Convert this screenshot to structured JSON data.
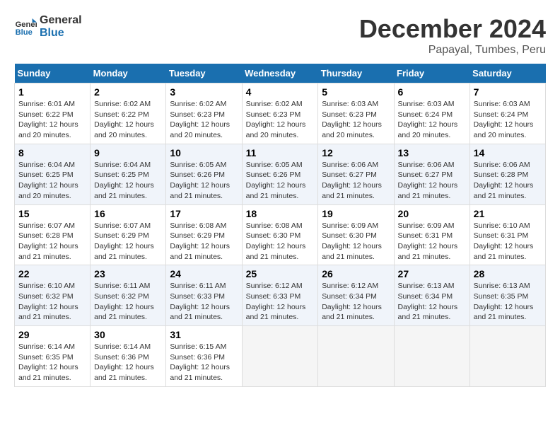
{
  "logo": {
    "line1": "General",
    "line2": "Blue"
  },
  "title": "December 2024",
  "location": "Papayal, Tumbes, Peru",
  "days_of_week": [
    "Sunday",
    "Monday",
    "Tuesday",
    "Wednesday",
    "Thursday",
    "Friday",
    "Saturday"
  ],
  "weeks": [
    [
      {
        "day": "1",
        "sunrise": "6:01 AM",
        "sunset": "6:22 PM",
        "daylight": "12 hours and 20 minutes."
      },
      {
        "day": "2",
        "sunrise": "6:02 AM",
        "sunset": "6:22 PM",
        "daylight": "12 hours and 20 minutes."
      },
      {
        "day": "3",
        "sunrise": "6:02 AM",
        "sunset": "6:23 PM",
        "daylight": "12 hours and 20 minutes."
      },
      {
        "day": "4",
        "sunrise": "6:02 AM",
        "sunset": "6:23 PM",
        "daylight": "12 hours and 20 minutes."
      },
      {
        "day": "5",
        "sunrise": "6:03 AM",
        "sunset": "6:23 PM",
        "daylight": "12 hours and 20 minutes."
      },
      {
        "day": "6",
        "sunrise": "6:03 AM",
        "sunset": "6:24 PM",
        "daylight": "12 hours and 20 minutes."
      },
      {
        "day": "7",
        "sunrise": "6:03 AM",
        "sunset": "6:24 PM",
        "daylight": "12 hours and 20 minutes."
      }
    ],
    [
      {
        "day": "8",
        "sunrise": "6:04 AM",
        "sunset": "6:25 PM",
        "daylight": "12 hours and 20 minutes."
      },
      {
        "day": "9",
        "sunrise": "6:04 AM",
        "sunset": "6:25 PM",
        "daylight": "12 hours and 21 minutes."
      },
      {
        "day": "10",
        "sunrise": "6:05 AM",
        "sunset": "6:26 PM",
        "daylight": "12 hours and 21 minutes."
      },
      {
        "day": "11",
        "sunrise": "6:05 AM",
        "sunset": "6:26 PM",
        "daylight": "12 hours and 21 minutes."
      },
      {
        "day": "12",
        "sunrise": "6:06 AM",
        "sunset": "6:27 PM",
        "daylight": "12 hours and 21 minutes."
      },
      {
        "day": "13",
        "sunrise": "6:06 AM",
        "sunset": "6:27 PM",
        "daylight": "12 hours and 21 minutes."
      },
      {
        "day": "14",
        "sunrise": "6:06 AM",
        "sunset": "6:28 PM",
        "daylight": "12 hours and 21 minutes."
      }
    ],
    [
      {
        "day": "15",
        "sunrise": "6:07 AM",
        "sunset": "6:28 PM",
        "daylight": "12 hours and 21 minutes."
      },
      {
        "day": "16",
        "sunrise": "6:07 AM",
        "sunset": "6:29 PM",
        "daylight": "12 hours and 21 minutes."
      },
      {
        "day": "17",
        "sunrise": "6:08 AM",
        "sunset": "6:29 PM",
        "daylight": "12 hours and 21 minutes."
      },
      {
        "day": "18",
        "sunrise": "6:08 AM",
        "sunset": "6:30 PM",
        "daylight": "12 hours and 21 minutes."
      },
      {
        "day": "19",
        "sunrise": "6:09 AM",
        "sunset": "6:30 PM",
        "daylight": "12 hours and 21 minutes."
      },
      {
        "day": "20",
        "sunrise": "6:09 AM",
        "sunset": "6:31 PM",
        "daylight": "12 hours and 21 minutes."
      },
      {
        "day": "21",
        "sunrise": "6:10 AM",
        "sunset": "6:31 PM",
        "daylight": "12 hours and 21 minutes."
      }
    ],
    [
      {
        "day": "22",
        "sunrise": "6:10 AM",
        "sunset": "6:32 PM",
        "daylight": "12 hours and 21 minutes."
      },
      {
        "day": "23",
        "sunrise": "6:11 AM",
        "sunset": "6:32 PM",
        "daylight": "12 hours and 21 minutes."
      },
      {
        "day": "24",
        "sunrise": "6:11 AM",
        "sunset": "6:33 PM",
        "daylight": "12 hours and 21 minutes."
      },
      {
        "day": "25",
        "sunrise": "6:12 AM",
        "sunset": "6:33 PM",
        "daylight": "12 hours and 21 minutes."
      },
      {
        "day": "26",
        "sunrise": "6:12 AM",
        "sunset": "6:34 PM",
        "daylight": "12 hours and 21 minutes."
      },
      {
        "day": "27",
        "sunrise": "6:13 AM",
        "sunset": "6:34 PM",
        "daylight": "12 hours and 21 minutes."
      },
      {
        "day": "28",
        "sunrise": "6:13 AM",
        "sunset": "6:35 PM",
        "daylight": "12 hours and 21 minutes."
      }
    ],
    [
      {
        "day": "29",
        "sunrise": "6:14 AM",
        "sunset": "6:35 PM",
        "daylight": "12 hours and 21 minutes."
      },
      {
        "day": "30",
        "sunrise": "6:14 AM",
        "sunset": "6:36 PM",
        "daylight": "12 hours and 21 minutes."
      },
      {
        "day": "31",
        "sunrise": "6:15 AM",
        "sunset": "6:36 PM",
        "daylight": "12 hours and 21 minutes."
      },
      null,
      null,
      null,
      null
    ]
  ]
}
